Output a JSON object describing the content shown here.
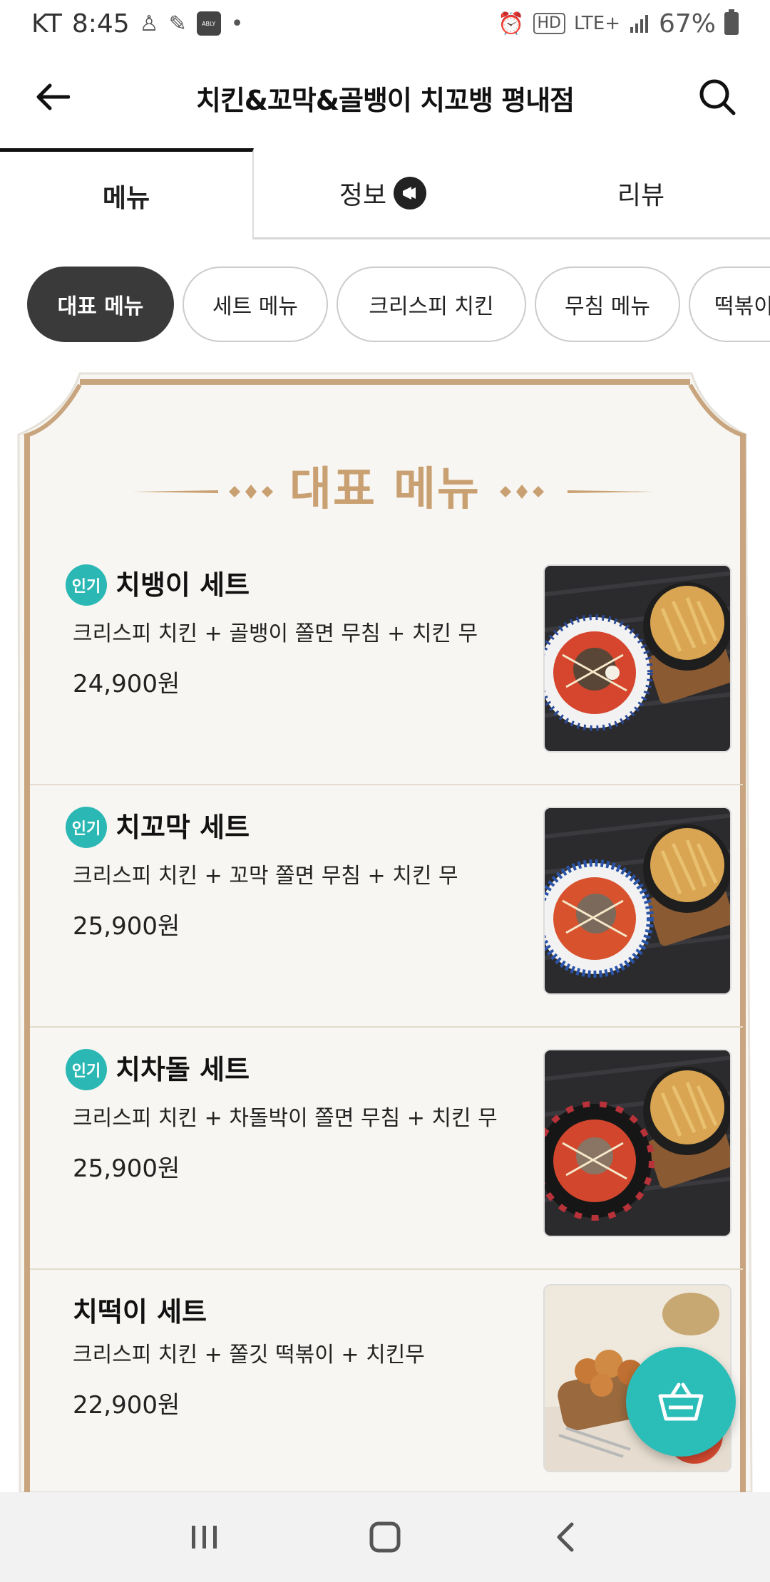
{
  "status_bar": {
    "carrier": "KT",
    "time": "8:45",
    "app_badge": "ABLY",
    "dot": "•",
    "hd_label": "HD",
    "network": "LTE+",
    "battery": "67%"
  },
  "header": {
    "title": "치킨&꼬막&골뱅이 치꼬뱅 평내점"
  },
  "tabs": [
    {
      "label": "메뉴"
    },
    {
      "label": "정보"
    },
    {
      "label": "리뷰"
    }
  ],
  "chips": [
    {
      "label": "대표 메뉴"
    },
    {
      "label": "세트 메뉴"
    },
    {
      "label": "크리스피 치킨"
    },
    {
      "label": "무침 메뉴"
    },
    {
      "label": "떡볶이"
    }
  ],
  "section": {
    "title": "대표 메뉴"
  },
  "menu_items": [
    {
      "badge": "인기",
      "name": "치뱅이 세트",
      "desc": "크리스피 치킨 + 골뱅이 쫄면 무침 + 치킨 무",
      "price": "24,900원"
    },
    {
      "badge": "인기",
      "name": "치꼬막 세트",
      "desc": "크리스피 치킨 + 꼬막 쫄면 무침 + 치킨 무",
      "price": "25,900원"
    },
    {
      "badge": "인기",
      "name": "치차돌 세트",
      "desc": "크리스피 치킨 + 차돌박이 쫄면 무침 + 치킨 무",
      "price": "25,900원"
    },
    {
      "badge": "",
      "name": "치떡이 세트",
      "desc": "크리스피 치킨 + 쫄깃 떡볶이 + 치킨무",
      "price": "22,900원"
    }
  ],
  "colors": {
    "accent": "#2bb8b4",
    "section_gold": "#c9a071",
    "chip_active": "#3a3a3a",
    "board_frame": "#c8a57e"
  },
  "icons": {
    "back": "arrow-left-icon",
    "search": "search-icon",
    "info": "megaphone-icon",
    "cart": "basket-icon",
    "nav_recent": "recent-apps-icon",
    "nav_home": "home-icon",
    "nav_back": "chevron-left-icon"
  }
}
